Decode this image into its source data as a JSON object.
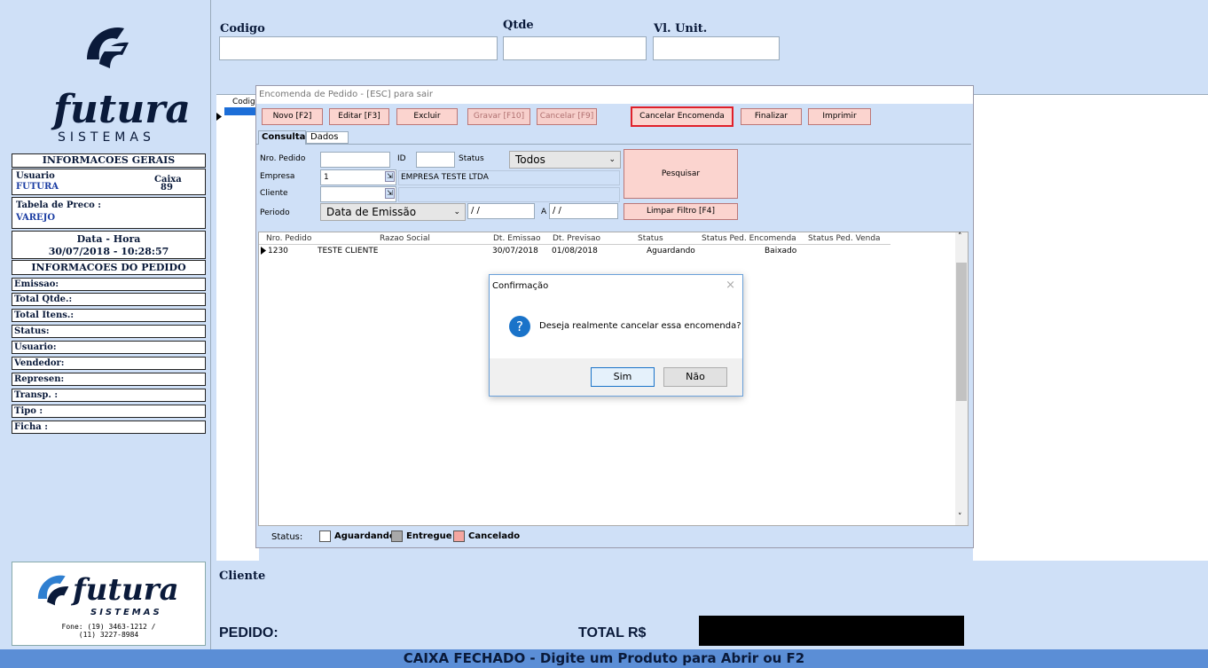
{
  "brand": {
    "name": "futura",
    "sub": "SISTEMAS",
    "phone": "Fone: (19) 3463-1212 /\n(11) 3227-8984"
  },
  "left": {
    "info_gerais": "INFORMACOES GERAIS",
    "usuario_label": "Usuario",
    "usuario_value": "FUTURA",
    "caixa_label": "Caixa",
    "caixa_value": "89",
    "tabela_label": "Tabela de Preco :",
    "tabela_value": "VAREJO",
    "data_hora_label": "Data - Hora",
    "data_hora_value": "30/07/2018 - 10:28:57",
    "info_pedido": "INFORMACOES DO PEDIDO",
    "fields": [
      "Emissao:",
      "Total Qtde.:",
      "Total Itens.:",
      "Status:",
      "Usuario:",
      "Vendedor:",
      "Represen:",
      "Transp. :",
      "Tipo :",
      "Ficha :"
    ]
  },
  "top": {
    "codigo": "Codigo",
    "qtde": "Qtde",
    "vl_unit": "Vl. Unit.",
    "grid_codigo": "Codig"
  },
  "encomenda": {
    "title": "Encomenda de Pedido - [ESC] para sair",
    "buttons": {
      "novo": "Novo [F2]",
      "editar": "Editar [F3]",
      "excluir": "Excluir",
      "gravar": "Gravar [F10]",
      "cancelar": "Cancelar [F9]",
      "cancelar_encomenda": "Cancelar Encomenda",
      "finalizar": "Finalizar",
      "imprimir": "Imprimir"
    },
    "tabs": {
      "consulta": "Consulta",
      "dados": "Dados"
    },
    "form": {
      "nro_pedido": "Nro. Pedido",
      "id": "ID",
      "status": "Status",
      "status_value": "Todos",
      "empresa": "Empresa",
      "empresa_id": "1",
      "empresa_name": "EMPRESA TESTE LTDA",
      "cliente": "Cliente",
      "periodo": "Periodo",
      "periodo_value": "Data de Emissão",
      "date_from": " / /",
      "a": "A",
      "date_to": " / /",
      "pesquisar": "Pesquisar",
      "limpar": "Limpar Filtro [F4]"
    },
    "grid": {
      "headers": {
        "nro": "Nro. Pedido",
        "razao": "Razao Social",
        "dt_emissao": "Dt. Emissao",
        "dt_previsao": "Dt. Previsao",
        "status": "Status",
        "status_enc": "Status Ped. Encomenda",
        "status_venda": "Status Ped. Venda"
      },
      "row": {
        "nro": "1230",
        "razao": "TESTE CLIENTE",
        "dt_emissao": "30/07/2018",
        "dt_previsao": "01/08/2018",
        "status": "Aguardando",
        "status_enc": "Baixado",
        "status_venda": ""
      }
    },
    "legend": {
      "label": "Status:",
      "aguardando": "Aguardando",
      "entregue": "Entregue",
      "cancelado": "Cancelado"
    }
  },
  "confirm": {
    "title": "Confirmação",
    "message": "Deseja realmente cancelar essa encomenda?",
    "sim": "Sim",
    "nao": "Não"
  },
  "bottom": {
    "cliente": "Cliente",
    "pedido": "PEDIDO:",
    "total": "TOTAL R$",
    "status_bar": "CAIXA FECHADO - Digite um Produto para Abrir ou F2"
  },
  "colors": {
    "accent": "#cfe0f7",
    "highlight_border": "#e0202a",
    "status_bar": "#5b8ed6"
  }
}
